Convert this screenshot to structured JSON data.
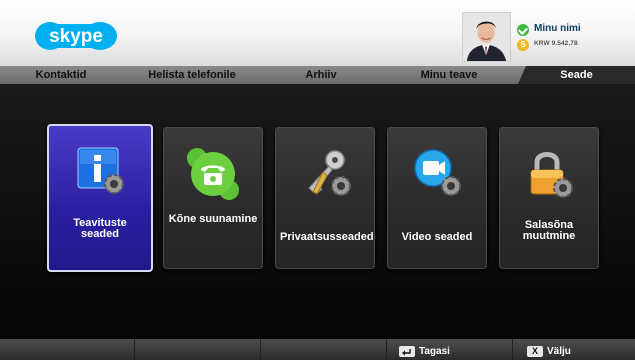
{
  "header": {
    "logo_text": "skype",
    "user": {
      "name": "Minu nimi",
      "balance": "KRW 9.542,78"
    }
  },
  "tabs": [
    {
      "label": "Kontaktid"
    },
    {
      "label": "Helista telefonile"
    },
    {
      "label": "Arhiiv"
    },
    {
      "label": "Minu teave"
    },
    {
      "label": "Seade"
    }
  ],
  "active_tab": "Seade",
  "settings_tiles": [
    {
      "label": "Teavituste seaded",
      "icon": "notification-info-icon",
      "selected": true
    },
    {
      "label": "Kõne suunamine",
      "icon": "phone-icon",
      "selected": false
    },
    {
      "label": "Privaatsusseaded",
      "icon": "keys-icon",
      "selected": false
    },
    {
      "label": "Video seaded",
      "icon": "video-camera-icon",
      "selected": false
    },
    {
      "label": "Salasõna muutmine",
      "icon": "padlock-icon",
      "selected": false
    }
  ],
  "footer": {
    "back_label": "Tagasi",
    "exit_label": "Välju",
    "exit_key": "X"
  },
  "colors": {
    "skype_blue": "#00aff0",
    "selected_tile": "#2a1fa0",
    "status_green": "#3bb93b"
  }
}
